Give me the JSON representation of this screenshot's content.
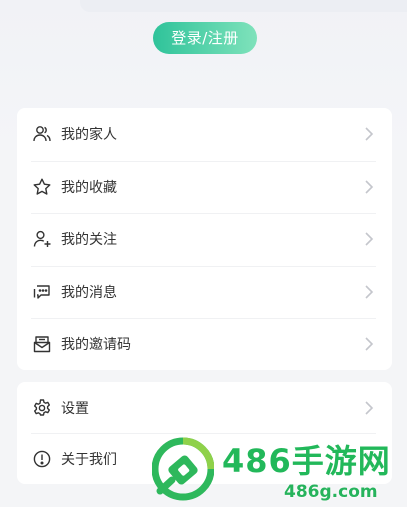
{
  "header": {
    "login_button": "登录/注册"
  },
  "menu_main": [
    {
      "label": "我的家人",
      "icon": "family-icon"
    },
    {
      "label": "我的收藏",
      "icon": "star-icon"
    },
    {
      "label": "我的关注",
      "icon": "follow-user-icon"
    },
    {
      "label": "我的消息",
      "icon": "message-icon"
    },
    {
      "label": "我的邀请码",
      "icon": "invite-mail-icon"
    }
  ],
  "menu_secondary": [
    {
      "label": "设置",
      "icon": "gear-icon"
    },
    {
      "label": "关于我们",
      "icon": "info-icon"
    }
  ],
  "watermark": {
    "title": "486手游网",
    "url": "486g.com"
  },
  "colors": {
    "accent_start": "#2fc39a",
    "accent_end": "#7fe2bb",
    "watermark_green": "#22b85a",
    "text": "#333333"
  }
}
